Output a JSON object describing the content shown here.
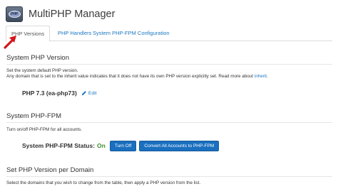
{
  "app": {
    "title": "MultiPHP Manager",
    "icon_name": "multiphp-manager-icon",
    "icon_text": "PHP"
  },
  "tabs": [
    {
      "label": "PHP Versions",
      "active": true
    },
    {
      "label": "PHP Handlers",
      "active": false
    },
    {
      "label": "System PHP-FPM Configuration",
      "active": false
    }
  ],
  "annotation_arrow": {
    "icon_name": "red-arrow-icon",
    "color": "#d3161b"
  },
  "system_php_version": {
    "heading": "System PHP Version",
    "desc_line1": "Set the system default PHP version.",
    "desc_line2": "Any domain that is set to the inherit value indicates that it does not have its own PHP version explicitly set. Read more about",
    "inherit_link": "inherit",
    "current_version": "PHP 7.3 (ea-php73)",
    "edit_label": "Edit"
  },
  "system_php_fpm": {
    "heading": "System PHP-FPM",
    "desc": "Turn on/off PHP-FPM for all accounts.",
    "status_label": "System PHP-FPM Status:",
    "status_value": "On",
    "turn_off_label": "Turn Off",
    "convert_label": "Convert All Accounts to PHP-FPM"
  },
  "per_domain": {
    "heading": "Set PHP Version per Domain",
    "desc": "Select the domains that you wish to change from the table, then apply a PHP version from the list."
  },
  "colors": {
    "link": "#1d78c1",
    "button_bg": "#1a6fbf",
    "status_on": "#3c8d2f"
  }
}
